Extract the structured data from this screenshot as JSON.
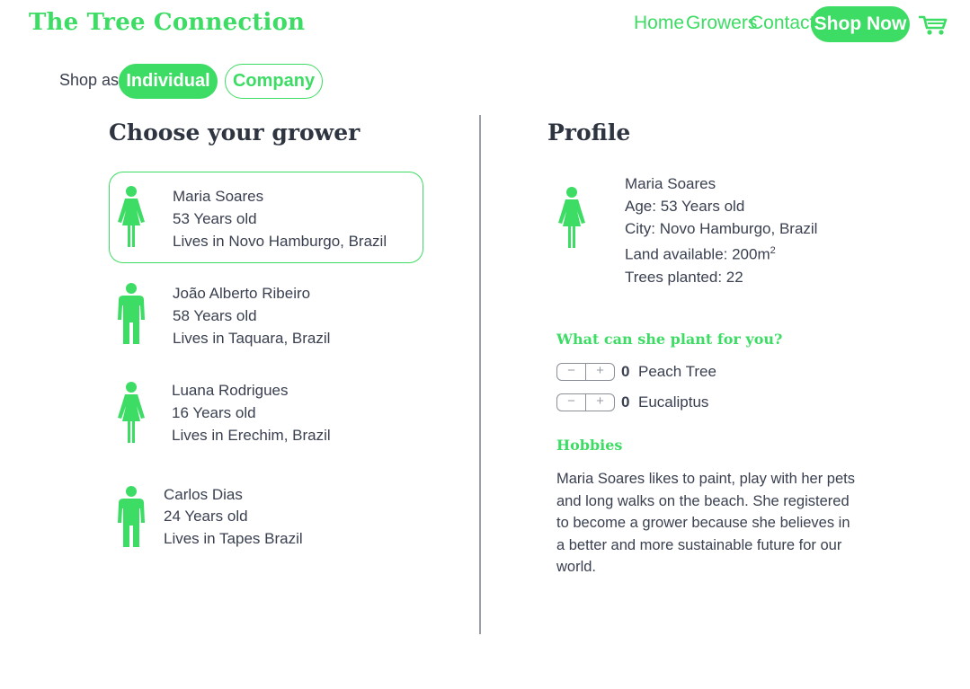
{
  "header": {
    "brand": "The Tree Connection",
    "nav": [
      "Home",
      "Growers",
      "Contact"
    ],
    "shop_now": "Shop Now",
    "cart_icon": "cart-icon"
  },
  "shop_as": {
    "label": "Shop as",
    "options": [
      "Individual",
      "Company"
    ],
    "selected": "Individual"
  },
  "colors": {
    "accent": "#3ddc64",
    "text": "#3a4050",
    "divider": "#9a9ea6"
  },
  "growers_section": {
    "title": "Choose your grower",
    "growers": [
      {
        "name": "Maria Soares",
        "age": "53 Years old",
        "location": "Lives in Novo Hamburgo, Brazil",
        "icon": "female-person-icon",
        "selected": true
      },
      {
        "name": "João Alberto Ribeiro",
        "age": "58 Years old",
        "location": "Lives in Taquara, Brazil",
        "icon": "male-person-icon",
        "selected": false
      },
      {
        "name": "Luana Rodrigues",
        "age": "16 Years old",
        "location": "Lives in Erechim, Brazil",
        "icon": "female-person-icon",
        "selected": false
      },
      {
        "name": "Carlos Dias",
        "age": "24 Years old",
        "location": "Lives in Tapes Brazil",
        "icon": "male-person-icon",
        "selected": false
      }
    ]
  },
  "profile": {
    "title": "Profile",
    "icon": "female-person-icon",
    "name": "Maria Soares",
    "age": "Age: 53 Years old",
    "city": "City: Novo Hamburgo, Brazil",
    "land_prefix": "Land available: 200m",
    "land_sup": "2",
    "trees": "Trees planted: 22",
    "plant_title": "What can she plant for you?",
    "trees_options": [
      {
        "name": "Peach Tree",
        "quantity": "0",
        "minus": "−",
        "plus": "+"
      },
      {
        "name": "Eucaliptus",
        "quantity": "0",
        "minus": "−",
        "plus": "+"
      }
    ],
    "hobbies_title": "Hobbies",
    "hobbies_text": "Maria Soares likes to paint, play with her pets and long walks on the beach. She registered to become a grower because she believes in a better and more sustainable future for our world."
  }
}
